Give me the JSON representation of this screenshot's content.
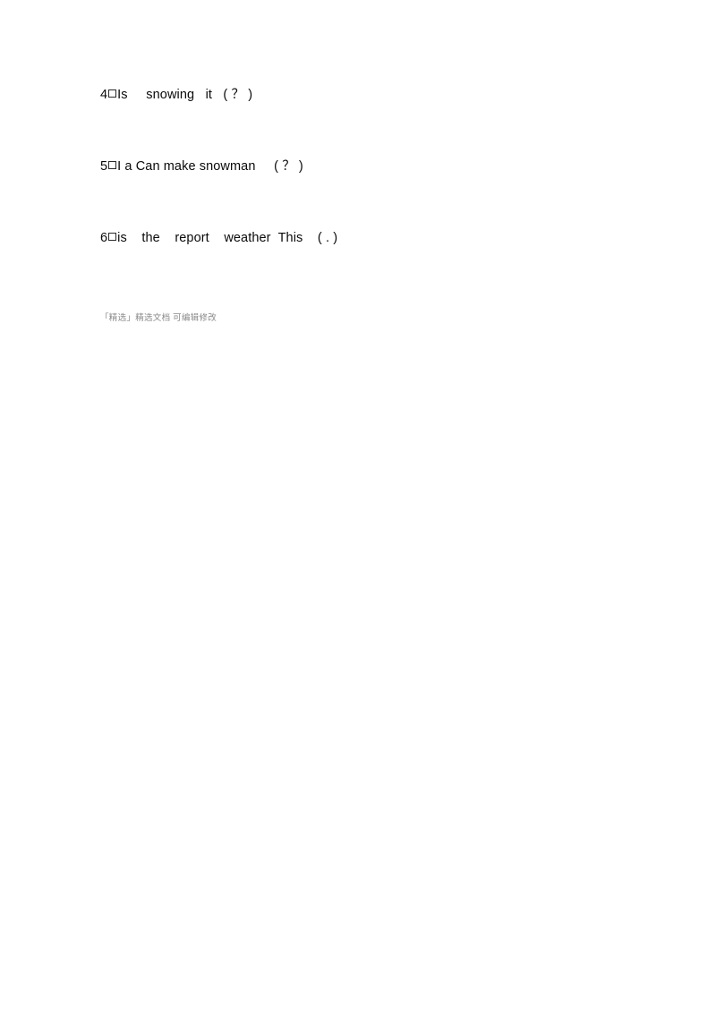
{
  "document": {
    "background_color": "#ffffff",
    "text_color": "#0a0a0a",
    "footer_color": "#8a8a8a",
    "questions": [
      {
        "number": "4",
        "separator": "□",
        "body": "Is     snowing   it   ( ？ )",
        "full_text": "4□Is     snowing   it   ( ？ )"
      },
      {
        "number": "5",
        "separator": "□",
        "body": "I a Can make snowman     ( ？ )",
        "full_text": "5□I a Can make snowman     ( ？ )"
      },
      {
        "number": "6",
        "separator": "□",
        "body": "is    the    report    weather  This    ( . )",
        "full_text": "6□is    the    report    weather  This    ( . )"
      }
    ],
    "footer": {
      "text": "「精选」精选文档 可编辑修改"
    }
  }
}
